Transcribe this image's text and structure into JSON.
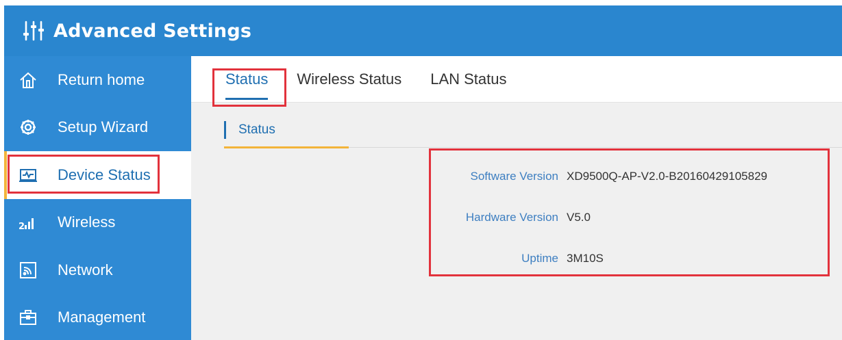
{
  "header": {
    "title": "Advanced Settings",
    "logo_icon": "sliders-icon"
  },
  "sidebar": {
    "items": [
      {
        "label": "Return home",
        "icon": "home-icon"
      },
      {
        "label": "Setup Wizard",
        "icon": "gear-icon"
      },
      {
        "label": "Device Status",
        "icon": "monitor-pulse-icon",
        "active": true
      },
      {
        "label": "Wireless",
        "icon": "signal-bars-icon"
      },
      {
        "label": "Network",
        "icon": "network-icon"
      },
      {
        "label": "Management",
        "icon": "toolbox-icon"
      }
    ]
  },
  "tabs": [
    {
      "label": "Status",
      "active": true
    },
    {
      "label": "Wireless Status"
    },
    {
      "label": "LAN Status"
    }
  ],
  "section": {
    "title": "Status"
  },
  "info": [
    {
      "label": "Software Version",
      "value": "XD9500Q-AP-V2.0-B20160429105829"
    },
    {
      "label": "Hardware Version",
      "value": "V5.0"
    },
    {
      "label": "Uptime",
      "value": "3M10S"
    }
  ],
  "colors": {
    "header_bg": "#2a86cf",
    "sidebar_bg": "#2f8ad4",
    "accent": "#1f6fb1",
    "highlight": "#f3b43a",
    "annotation": "#e2323c"
  }
}
